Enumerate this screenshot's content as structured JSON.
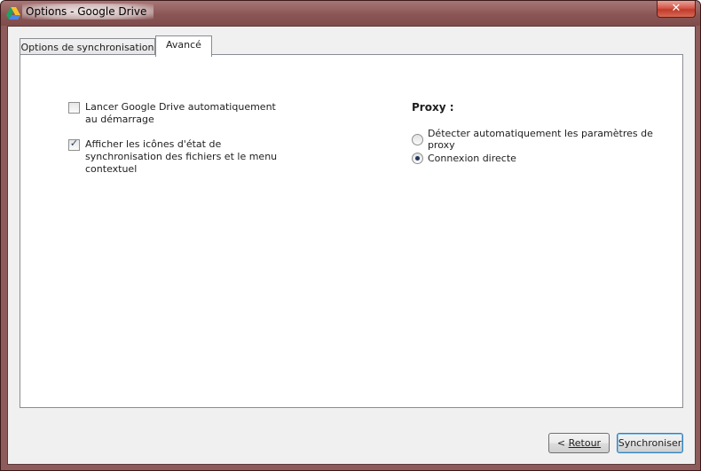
{
  "window": {
    "title": "Options - Google Drive",
    "close_label": "✕",
    "icon": "google-drive-icon"
  },
  "tabs": [
    {
      "label": "Options de synchronisation",
      "selected": false
    },
    {
      "label": "Avancé",
      "selected": true
    }
  ],
  "left": {
    "auto_launch": {
      "label_line1": "Lancer Google Drive automatiquement",
      "label_line2": "au démarrage",
      "checked": false
    },
    "sync_icons": {
      "label_line1": "Afficher les icônes d'état de",
      "label_line2": "synchronisation des fichiers et le menu",
      "label_line3": "contextuel",
      "checked": true
    }
  },
  "proxy": {
    "title": "Proxy :",
    "options": [
      {
        "label": "Détecter automatiquement les paramètres de proxy",
        "selected": false
      },
      {
        "label": "Connexion directe",
        "selected": true
      }
    ]
  },
  "buttons": {
    "back_prefix": "< ",
    "back_label": "Retour",
    "sync_label": "Synchroniser"
  },
  "colors": {
    "title_bar": "#8b5555",
    "close_button": "#c13a2b",
    "focus_border": "#3c7fb1"
  }
}
